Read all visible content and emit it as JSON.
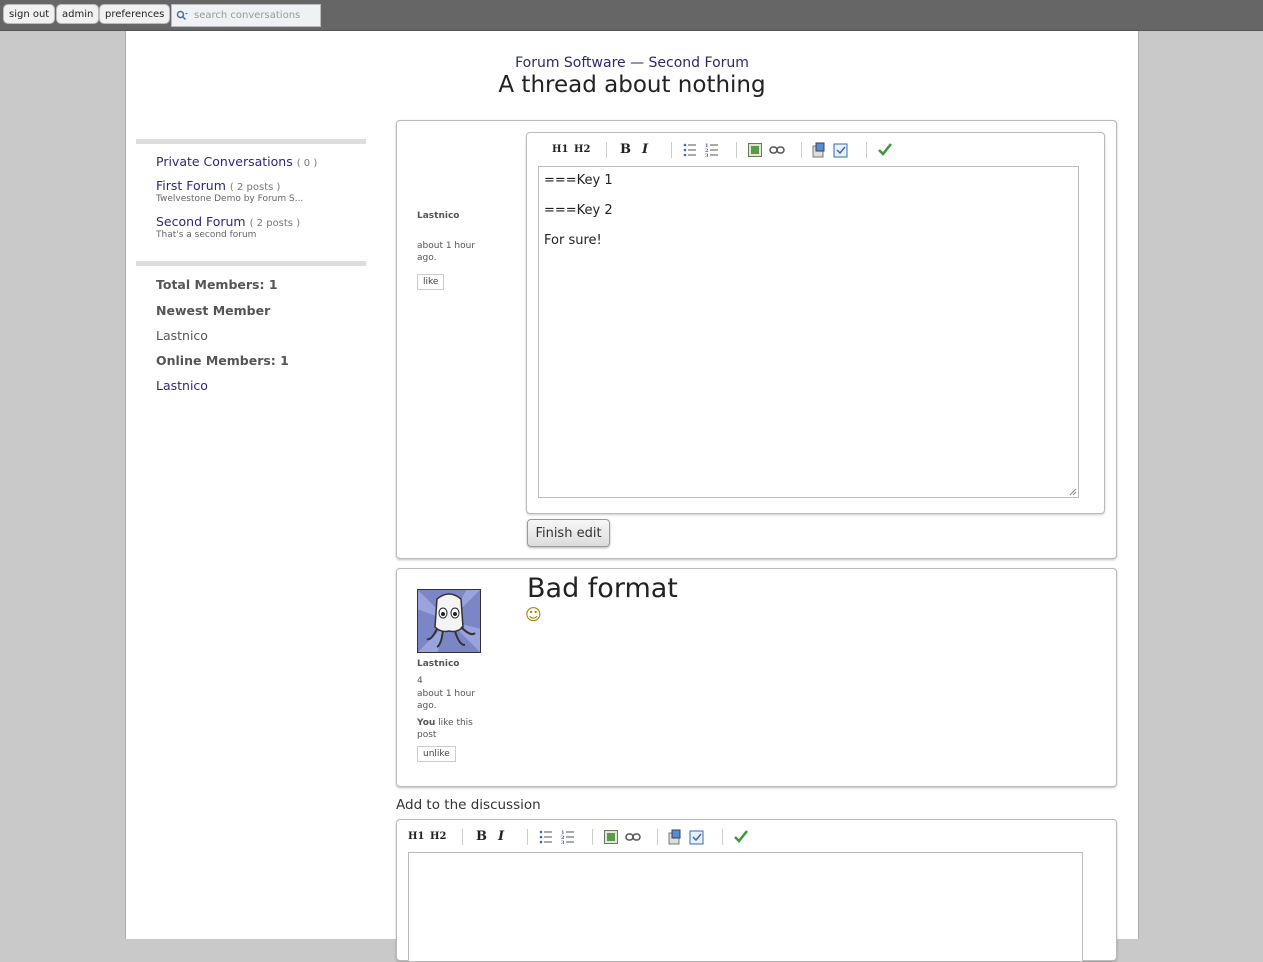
{
  "topbar": {
    "buttons": {
      "sign_out": "sign out",
      "admin": "admin",
      "preferences": "preferences"
    },
    "search_placeholder": "search conversations",
    "search_icon": "magnifier-icon"
  },
  "breadcrumb": {
    "parent": "Forum Software",
    "separator": "—",
    "current": "Second Forum"
  },
  "thread_title": "A thread about nothing",
  "sidebar": {
    "items": [
      {
        "label": "Private Conversations",
        "count": "( 0 )",
        "desc": ""
      },
      {
        "label": "First Forum",
        "count": "( 2 posts )",
        "desc": "Twelvestone Demo by Forum S..."
      },
      {
        "label": "Second Forum",
        "count": "( 2 posts )",
        "desc": "That's a second forum"
      }
    ],
    "stats": {
      "total_members": "Total Members: 1",
      "newest_member_heading": "Newest Member",
      "newest_member": "Lastnico",
      "online_members": "Online Members: 1",
      "online_member": "Lastnico"
    }
  },
  "editing_post": {
    "author": "Lastnico",
    "time": "about 1 hour ago.",
    "like_label": "like",
    "editor_lines": [
      "===Key 1",
      "===Key 2",
      "For sure!"
    ],
    "finish_label": "Finish edit"
  },
  "toolbar": {
    "h1": "H1",
    "h2": "H2",
    "bold": "B",
    "italic": "I",
    "icons": [
      "bullet-list-icon",
      "numbered-list-icon",
      "image-icon",
      "link-icon",
      "quote-icon",
      "preview-icon",
      "check-icon"
    ]
  },
  "second_post": {
    "title": "Bad format",
    "smiley": "☺",
    "author": "Lastnico",
    "post_count": "4",
    "time": "about 1 hour ago.",
    "you_label": "You",
    "like_text": "like this post",
    "unlike_label": "unlike"
  },
  "add_discussion_label": "Add to the discussion",
  "colors": {
    "topbar": "#666666",
    "link": "#2a2a7a",
    "background": "#c9c9c9"
  }
}
